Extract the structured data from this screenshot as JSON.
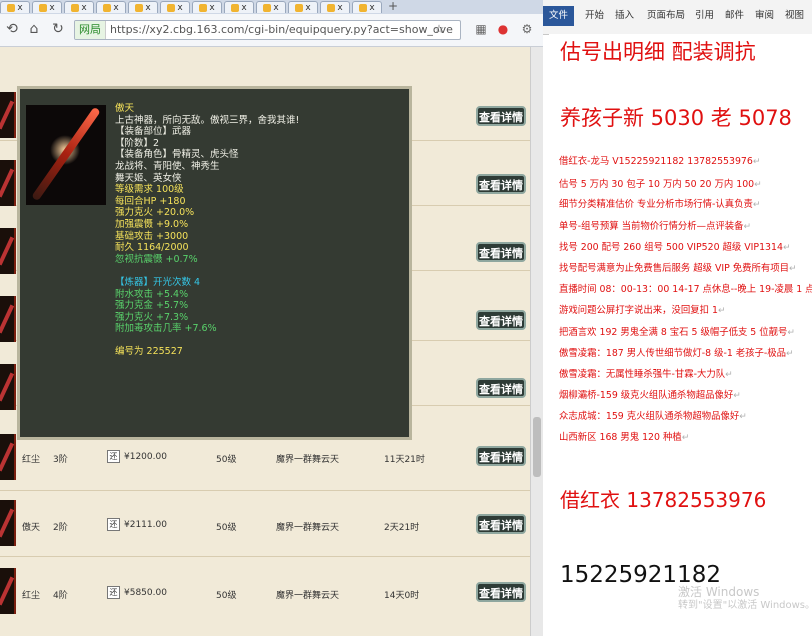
{
  "browser": {
    "tabs": [
      "x",
      "x",
      "x",
      "x",
      "x",
      "x",
      "x",
      "x",
      "x",
      "x",
      "x",
      "x"
    ],
    "new_tab": "+",
    "url_badge": "网局",
    "url": "https://xy2.cbg.163.com/cgi-bin/equipquery.py?act=show_ove",
    "nav_icons": [
      "back-icon",
      "home-icon",
      "refresh-icon"
    ],
    "toolbar_icons": [
      "star-icon",
      "grid-icon",
      "gamepad-icon",
      "settings-icon"
    ]
  },
  "listing": {
    "detail_label": "查看详情",
    "rows": [
      {
        "name": "红尘",
        "rank": "3阶",
        "check": "还",
        "price": "¥1200.00",
        "level": "50级",
        "server": "魔界一群舞云天",
        "time": "11天21时"
      },
      {
        "name": "傲天",
        "rank": "2阶",
        "check": "还",
        "price": "¥2111.00",
        "level": "50级",
        "server": "魔界一群舞云天",
        "time": "2天21时"
      },
      {
        "name": "红尘",
        "rank": "4阶",
        "check": "还",
        "price": "¥5850.00",
        "level": "50级",
        "server": "魔界一群舞云天",
        "time": "14天0时"
      }
    ]
  },
  "tooltip": {
    "lines": [
      {
        "t": "傲天",
        "c": "y"
      },
      {
        "t": "上古神器，所向无敌。傲视三界，舍我其谁!",
        "c": "w"
      },
      {
        "t": "【装备部位】武器",
        "c": "w"
      },
      {
        "t": "【阶数】2",
        "c": "w"
      },
      {
        "t": "【装备角色】骨精灵、虎头怪",
        "c": "w"
      },
      {
        "t": "龙战将、青阳使、神秀生",
        "c": "w"
      },
      {
        "t": "舞天姬、英女侠",
        "c": "w"
      },
      {
        "t": "等级需求 100级",
        "c": "y"
      },
      {
        "t": "每回合HP +180",
        "c": "y"
      },
      {
        "t": "强力克火 +20.0%",
        "c": "y"
      },
      {
        "t": "加强震慑 +9.0%",
        "c": "y"
      },
      {
        "t": "基础攻击 +3000",
        "c": "y"
      },
      {
        "t": "耐久 1164/2000",
        "c": "y"
      },
      {
        "t": "忽视抗震慑 +0.7%",
        "c": "g"
      },
      {
        "t": "",
        "c": "w"
      },
      {
        "t": "【炼器】开光次数 4",
        "c": "c"
      },
      {
        "t": "附水攻击 +5.4%",
        "c": "g"
      },
      {
        "t": "强力克金 +5.7%",
        "c": "g"
      },
      {
        "t": "强力克火 +7.3%",
        "c": "g"
      },
      {
        "t": "附加毒攻击几率 +7.6%",
        "c": "g"
      },
      {
        "t": "",
        "c": "w"
      },
      {
        "t": "编号为 225527",
        "c": "y"
      }
    ]
  },
  "word": {
    "ribbon_tabs": [
      "文件",
      "开始",
      "插入",
      "页面布局",
      "引用",
      "邮件",
      "审阅",
      "视图"
    ],
    "heading1": "估号出明细 配装调抗",
    "heading2": "养孩子新 5030 老 5078",
    "lines": [
      "借红衣-龙马 V15225921182    13782553976",
      "估号 5 万内 30 包子  10 万内 50  20 万内 100",
      "细节分类精准估价  专业分析市场行情-认真负责",
      "单号-组号预算   当前物价行情分析—点评装备",
      "找号 200    配号 260    组号 500 VIP520    超级 VIP1314",
      "找号配号满意为止免费售后服务   超级 VIP 免费所有项目",
      "直播时间 08：00-13：00 14-17 点休息--晚上 19-凌晨 1 点",
      "游戏问题公屏打字说出来，没回复扣 1",
      "把酒言欢 192 男鬼全满 8 宝石 5 级帽子低支 5 位靓号",
      "傲雪凌霜：187 男人传世细节做灯-8 级-1 老孩子-极品",
      "傲雪凌霜：无属性睡杀强牛-甘霖-大力队",
      "烟柳灞桥-159 级克火组队通杀物超品像好",
      "众志成城：159 克火组队通杀物超物品像好",
      "山西新区 168 男鬼 120 种植"
    ],
    "big_contact": "借红衣 13782553976",
    "phone": "15225921182",
    "watermark1": "激活 Windows",
    "watermark2": "转到\"设置\"以激活 Windows。"
  }
}
